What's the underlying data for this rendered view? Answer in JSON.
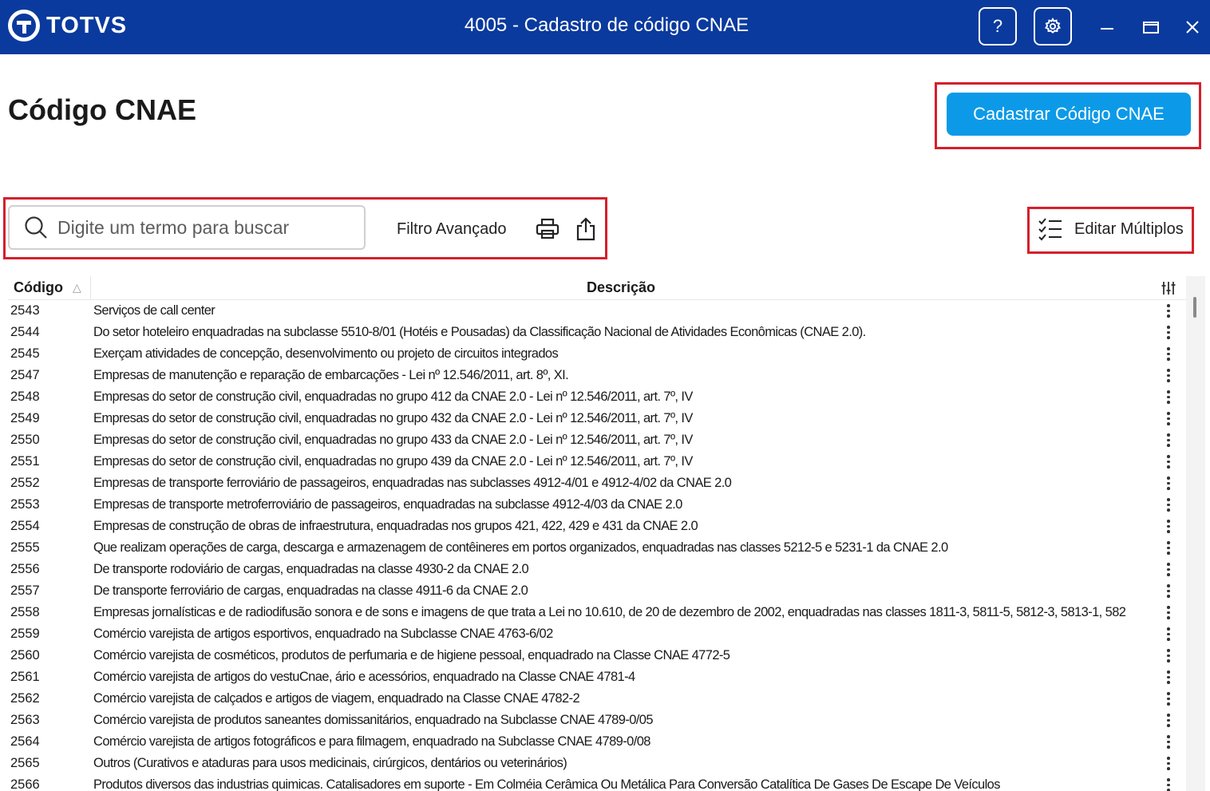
{
  "titlebar": {
    "brand": "TOTVS",
    "title": "4005 - Cadastro de código CNAE",
    "help_label": "?"
  },
  "page": {
    "title": "Código CNAE",
    "primary_action": "Cadastrar Código CNAE"
  },
  "toolbar": {
    "search_placeholder": "Digite um termo para buscar",
    "advanced_filter": "Filtro Avançado",
    "edit_multiple": "Editar Múltiplos"
  },
  "table": {
    "columns": {
      "code": "Código",
      "description": "Descrição"
    },
    "rows": [
      {
        "code": "2543",
        "desc": "Serviços de call center"
      },
      {
        "code": "2544",
        "desc": "Do setor hoteleiro enquadradas na subclasse 5510-8/01 (Hotéis e Pousadas) da Classificação Nacional de Atividades Econômicas (CNAE 2.0)."
      },
      {
        "code": "2545",
        "desc": "Exerçam atividades de concepção, desenvolvimento ou projeto de circuitos integrados"
      },
      {
        "code": "2547",
        "desc": "Empresas de manutenção e reparação de embarcações - Lei nº 12.546/2011, art. 8º, XI."
      },
      {
        "code": "2548",
        "desc": "Empresas do setor de construção civil, enquadradas no grupo 412 da CNAE 2.0 - Lei nº 12.546/2011, art. 7º, IV"
      },
      {
        "code": "2549",
        "desc": "Empresas do setor de construção civil, enquadradas no grupo 432 da CNAE 2.0 - Lei nº 12.546/2011, art. 7º, IV"
      },
      {
        "code": "2550",
        "desc": "Empresas do setor de construção civil, enquadradas no grupo 433 da CNAE 2.0 - Lei nº 12.546/2011, art. 7º, IV"
      },
      {
        "code": "2551",
        "desc": "Empresas do setor de construção civil, enquadradas no grupo 439 da CNAE 2.0 - Lei nº 12.546/2011, art. 7º, IV"
      },
      {
        "code": "2552",
        "desc": "Empresas de transporte ferroviário de passageiros, enquadradas nas subclasses 4912-4/01 e 4912-4/02 da CNAE 2.0"
      },
      {
        "code": "2553",
        "desc": "Empresas de transporte metroferroviário de passageiros, enquadradas na subclasse 4912-4/03 da CNAE 2.0"
      },
      {
        "code": "2554",
        "desc": "Empresas de construção de obras de infraestrutura, enquadradas nos grupos 421, 422, 429 e 431 da CNAE 2.0"
      },
      {
        "code": "2555",
        "desc": "Que realizam operações de carga, descarga e armazenagem de contêineres em portos organizados, enquadradas nas classes 5212-5 e 5231-1 da CNAE 2.0"
      },
      {
        "code": "2556",
        "desc": "De transporte rodoviário de cargas, enquadradas na classe 4930-2 da CNAE 2.0"
      },
      {
        "code": "2557",
        "desc": "De transporte ferroviário de cargas, enquadradas na classe 4911-6 da CNAE 2.0"
      },
      {
        "code": "2558",
        "desc": "Empresas jornalísticas e de radiodifusão sonora e de sons e imagens de que trata a Lei no 10.610, de 20 de dezembro de 2002, enquadradas nas classes 1811-3, 5811-5, 5812-3, 5813-1, 582"
      },
      {
        "code": "2559",
        "desc": "Comércio varejista de artigos esportivos, enquadrado na Subclasse CNAE 4763-6/02"
      },
      {
        "code": "2560",
        "desc": "Comércio varejista de cosméticos, produtos de perfumaria e de higiene pessoal, enquadrado na Classe CNAE 4772-5"
      },
      {
        "code": "2561",
        "desc": "Comércio varejista de artigos do vestuCnae, ário e acessórios, enquadrado na Classe CNAE 4781-4"
      },
      {
        "code": "2562",
        "desc": "Comércio varejista de calçados e artigos de viagem, enquadrado na Classe CNAE 4782-2"
      },
      {
        "code": "2563",
        "desc": "Comércio varejista de produtos saneantes domissanitários, enquadrado na Subclasse CNAE 4789-0/05"
      },
      {
        "code": "2564",
        "desc": "Comércio varejista de artigos fotográficos e para filmagem, enquadrado na Subclasse CNAE 4789-0/08"
      },
      {
        "code": "2565",
        "desc": "Outros (Curativos e ataduras para usos medicinais, cirúrgicos, dentários ou veterinários)"
      },
      {
        "code": "2566",
        "desc": "Produtos diversos das industrias quimicas. Catalisadores em suporte - Em Colméia Cerâmica Ou Metálica Para Conversão Catalítica De Gases De Escape De Veículos"
      }
    ]
  },
  "colors": {
    "titlebar_bg": "#0a3a9e",
    "primary": "#0c9ae8",
    "highlight": "#d4202c"
  }
}
